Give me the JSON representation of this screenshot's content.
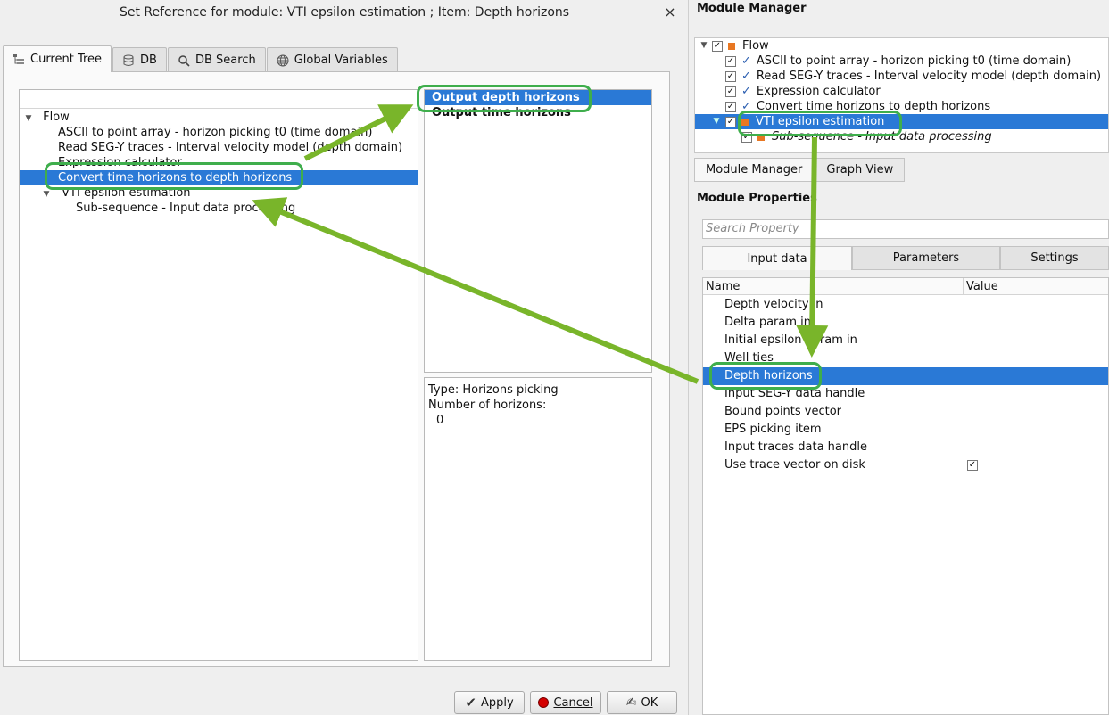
{
  "dialog": {
    "title": "Set Reference for module: VTI epsilon estimation ; Item: Depth horizons",
    "close_glyph": "×",
    "tabs": [
      {
        "label": "Current Tree",
        "icon": "tree-icon"
      },
      {
        "label": "DB",
        "icon": "database-icon"
      },
      {
        "label": "DB Search",
        "icon": "search-icon"
      },
      {
        "label": "Global Variables",
        "icon": "globe-icon"
      }
    ],
    "tree": {
      "root": "Flow",
      "items": [
        "ASCII to point array - horizon picking t0 (time domain)",
        "Read SEG-Y traces - Interval velocity model (depth domain)",
        "Expression calculator",
        "Convert time horizons to depth horizons",
        "VTI epsilon estimation",
        "Sub-sequence - Input data processing"
      ],
      "selected_index": 3
    },
    "output_items": [
      "Output depth horizons",
      "Output time horizons"
    ],
    "info": {
      "type_line": "Type: Horizons picking",
      "count_label": "Number of horizons:",
      "count_value": "0"
    },
    "buttons": {
      "apply": "Apply",
      "cancel": "Cancel",
      "ok": "OK"
    }
  },
  "module_manager": {
    "title": "Module Manager",
    "tree": {
      "root": "Flow",
      "items": [
        "ASCII to point array - horizon picking t0 (time domain)",
        "Read SEG-Y traces - Interval velocity model (depth domain)",
        "Expression calculator",
        "Convert time horizons to depth horizons",
        "VTI epsilon estimation",
        "Sub-sequence - Input data processing"
      ]
    },
    "tabs": [
      "Module Manager",
      "Graph View"
    ],
    "properties_title": "Module Properties",
    "search_placeholder": "Search Property",
    "prop_tabs": [
      "Input data",
      "Parameters",
      "Settings"
    ],
    "columns": {
      "name": "Name",
      "value": "Value"
    },
    "rows": [
      "Depth velocity in",
      "Delta param in",
      "Initial epsilon param in",
      "Well ties",
      "Depth horizons",
      "Input SEG-Y data handle",
      "Bound points vector",
      "EPS picking item",
      "Input traces data handle",
      "Use trace vector on disk"
    ],
    "checked_row": "Use trace vector on disk"
  },
  "colors": {
    "selection": "#2a79d6",
    "highlight": "#3fae4c",
    "arrow": "#79b52a",
    "module_square": "#e87722"
  }
}
